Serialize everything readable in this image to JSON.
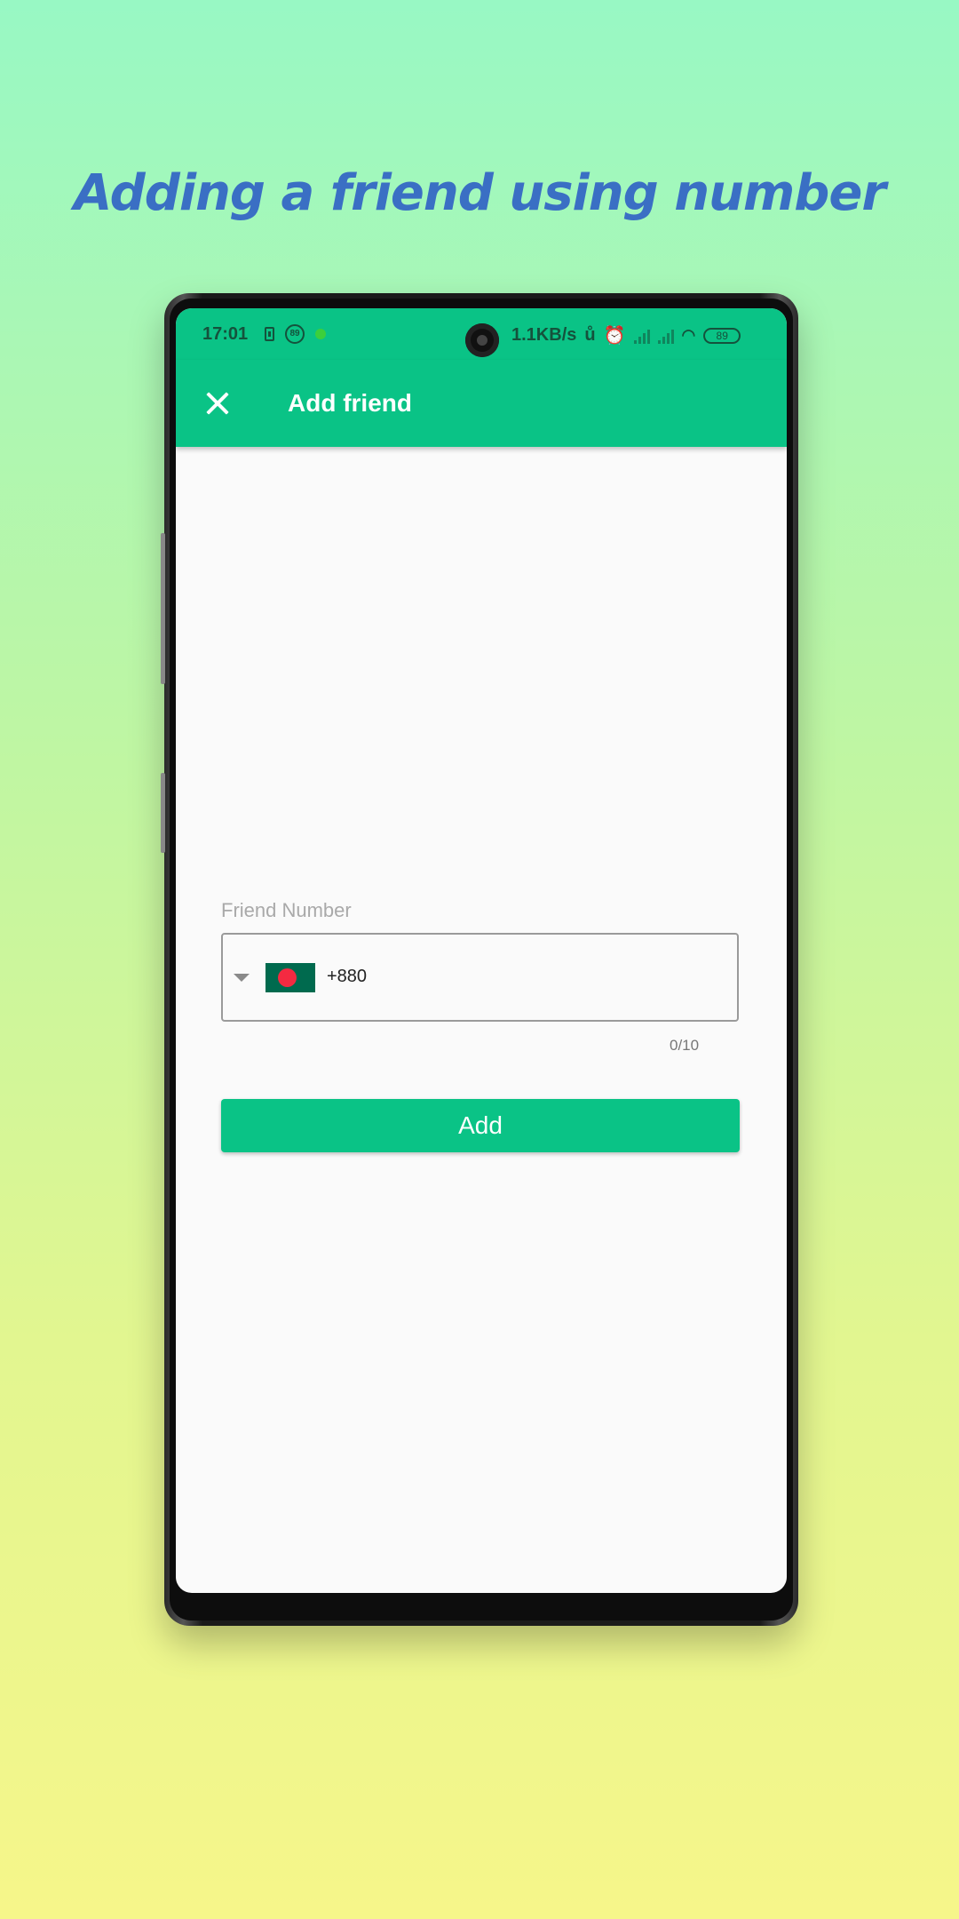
{
  "headline": "Adding a friend using number",
  "status_bar": {
    "time": "17:01",
    "notification_badge": "89",
    "network_speed": "1.1KB/s",
    "battery": "89"
  },
  "app_bar": {
    "title": "Add friend",
    "close_icon": "close-icon"
  },
  "form": {
    "label": "Friend Number",
    "country_flag": "bangladesh-flag",
    "dial_code": "+880",
    "value": "",
    "counter": "0/10",
    "submit_label": "Add"
  },
  "colors": {
    "primary": "#0ac386",
    "headline": "#3a6fc4",
    "flag_green": "#006a4e",
    "flag_red": "#f42a41"
  }
}
